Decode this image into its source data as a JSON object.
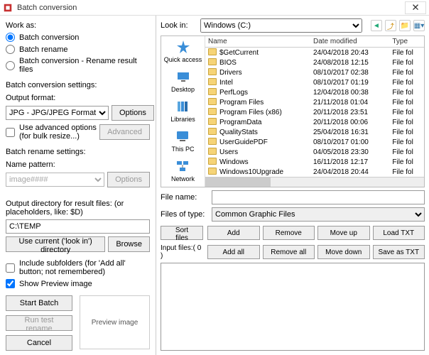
{
  "window": {
    "title": "Batch conversion"
  },
  "left": {
    "work_as": "Work as:",
    "radios": {
      "r1": "Batch conversion",
      "r2": "Batch rename",
      "r3": "Batch conversion - Rename result files"
    },
    "bc_settings": "Batch conversion settings:",
    "output_format": "Output format:",
    "format_value": "JPG - JPG/JPEG Format",
    "options_btn": "Options",
    "use_advanced": "Use advanced options (for bulk resize...)",
    "advanced_btn": "Advanced",
    "br_settings": "Batch rename settings:",
    "name_pattern": "Name pattern:",
    "pattern_value": "image####",
    "output_dir_label": "Output directory for result files: (or placeholders, like: $D)",
    "output_dir_value": "C:\\TEMP",
    "use_current": "Use current ('look in') directory",
    "browse": "Browse",
    "include_sub": "Include subfolders (for 'Add all' button; not remembered)",
    "show_preview": "Show Preview image",
    "start_batch": "Start Batch",
    "run_test": "Run test rename",
    "cancel": "Cancel",
    "preview": "Preview image"
  },
  "right": {
    "look_in": "Look in:",
    "drive": "Windows (C:)",
    "tool_back": "←",
    "tool_up": "↑",
    "tool_new": "📁",
    "tool_view": "▦",
    "places": {
      "quick": "Quick access",
      "desktop": "Desktop",
      "libraries": "Libraries",
      "thispc": "This PC",
      "network": "Network"
    },
    "cols": {
      "name": "Name",
      "date": "Date modified",
      "type": "Type"
    },
    "rows": [
      {
        "n": "$GetCurrent",
        "d": "24/04/2018 20:43",
        "t": "File fol"
      },
      {
        "n": "BIOS",
        "d": "24/08/2018 12:15",
        "t": "File fol"
      },
      {
        "n": "Drivers",
        "d": "08/10/2017 02:38",
        "t": "File fol"
      },
      {
        "n": "Intel",
        "d": "08/10/2017 01:19",
        "t": "File fol"
      },
      {
        "n": "PerfLogs",
        "d": "12/04/2018 00:38",
        "t": "File fol"
      },
      {
        "n": "Program Files",
        "d": "21/11/2018 01:04",
        "t": "File fol"
      },
      {
        "n": "Program Files (x86)",
        "d": "20/11/2018 23:51",
        "t": "File fol"
      },
      {
        "n": "ProgramData",
        "d": "20/11/2018 00:06",
        "t": "File fol"
      },
      {
        "n": "QualityStats",
        "d": "25/04/2018 16:31",
        "t": "File fol"
      },
      {
        "n": "UserGuidePDF",
        "d": "08/10/2017 01:00",
        "t": "File fol"
      },
      {
        "n": "Users",
        "d": "04/05/2018 23:30",
        "t": "File fol"
      },
      {
        "n": "Windows",
        "d": "16/11/2018 12:17",
        "t": "File fol"
      },
      {
        "n": "Windows10Upgrade",
        "d": "24/04/2018 20:44",
        "t": "File fol"
      }
    ],
    "file_name": "File name:",
    "files_of_type": "Files of type:",
    "type_value": "Common Graphic Files",
    "sort_files": "Sort files",
    "input_files": "Input files:( 0 )",
    "btns": {
      "add": "Add",
      "remove": "Remove",
      "moveup": "Move up",
      "loadtxt": "Load TXT",
      "addall": "Add all",
      "removeall": "Remove all",
      "movedown": "Move down",
      "savetxt": "Save as TXT"
    }
  }
}
